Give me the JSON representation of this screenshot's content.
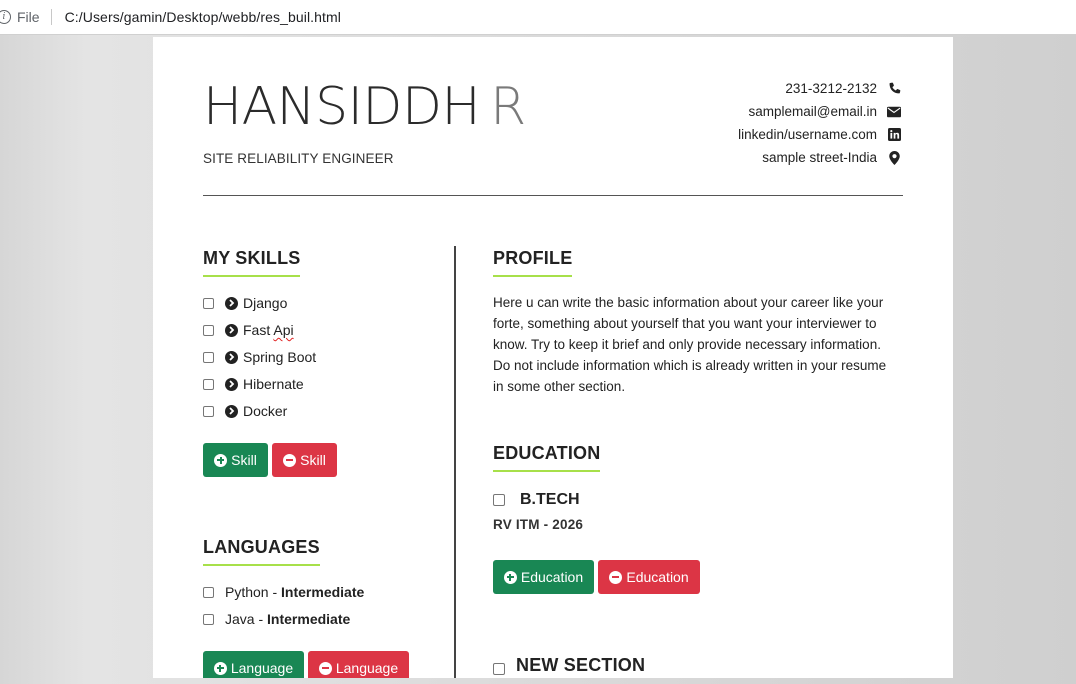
{
  "browser": {
    "file_label": "File",
    "url": "C:/Users/gamin/Desktop/webb/res_buil.html"
  },
  "header": {
    "first_name": "HANSIDDH",
    "initial": "R",
    "role": "SITE RELIABILITY ENGINEER",
    "contact": {
      "phone": "231-3212-2132",
      "email": "samplemail@email.in",
      "linkedin": "linkedin/username.com",
      "address": "sample street-India"
    }
  },
  "skills": {
    "title": "MY SKILLS",
    "items": [
      "Django",
      "Fast Api",
      "Spring Boot",
      "Hibernate",
      "Docker"
    ],
    "add_label": "Skill",
    "remove_label": "Skill"
  },
  "languages": {
    "title": "LANGUAGES",
    "items": [
      {
        "name": "Python",
        "sep": " - ",
        "level": "Intermediate"
      },
      {
        "name": "Java",
        "sep": " - ",
        "level": "Intermediate"
      }
    ],
    "add_label": "Language",
    "remove_label": "Language"
  },
  "profile": {
    "title": "PROFILE",
    "text": "Here u can write the basic information about your career like your forte, something about yourself that you want your interviewer to know. Try to keep it brief and only provide necessary information. Do not include information which is already written in your resume in some other section."
  },
  "education": {
    "title": "EDUCATION",
    "degree": "B.TECH",
    "institute": "RV ITM - 2026",
    "add_label": "Education",
    "remove_label": "Education"
  },
  "new_section": {
    "title": "NEW SECTION"
  },
  "colors": {
    "accent_underline": "#a7e04a",
    "add_button": "#198754",
    "remove_button": "#dc3545"
  },
  "icons": [
    "info-icon",
    "phone-icon",
    "envelope-icon",
    "linkedin-icon",
    "map-marker-icon",
    "chevron-circle-right-icon",
    "plus-circle-icon",
    "minus-circle-icon"
  ]
}
